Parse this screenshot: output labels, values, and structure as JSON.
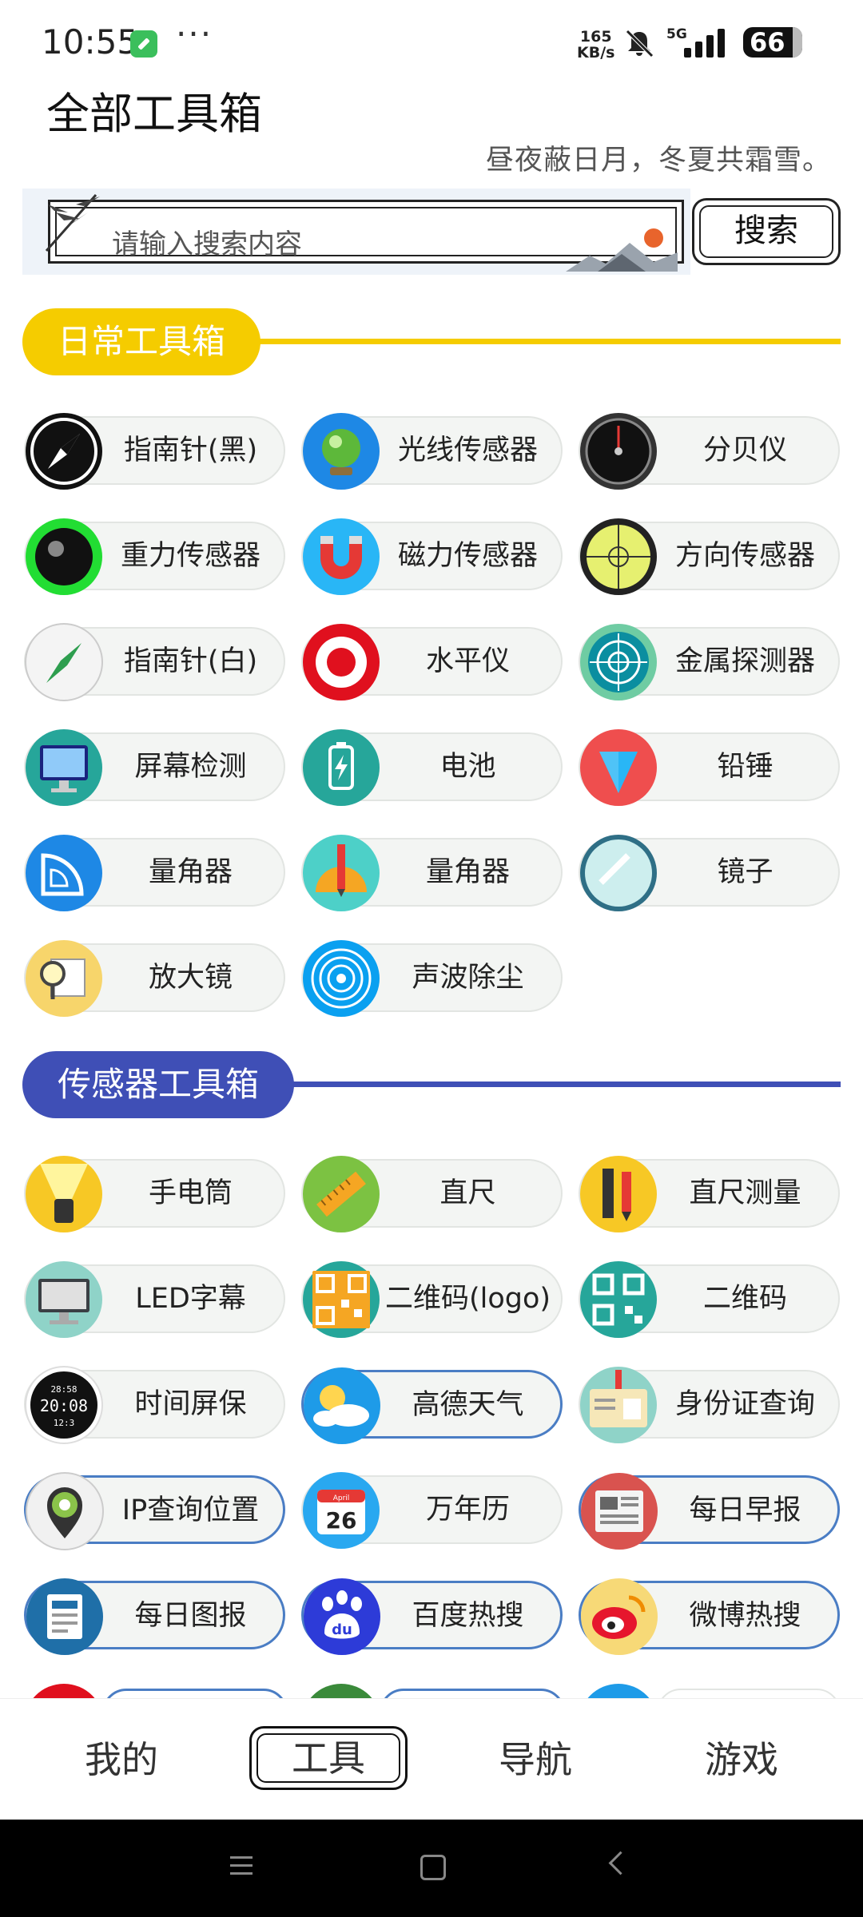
{
  "status_bar": {
    "time": "10:55",
    "dots": "···",
    "speed_value": "165",
    "speed_unit": "KB/s",
    "network": "5G",
    "battery": "66"
  },
  "header": {
    "title": "全部工具箱",
    "slogan": "昼夜蔽日月，冬夏共霜雪。"
  },
  "search": {
    "placeholder": "请输入搜索内容",
    "button_label": "搜索"
  },
  "sections": [
    {
      "title": "日常工具箱",
      "color": "#f5cc00",
      "tools": [
        {
          "label": "指南针(黑)",
          "icon": "compass-black-icon"
        },
        {
          "label": "光线传感器",
          "icon": "light-sensor-icon"
        },
        {
          "label": "分贝仪",
          "icon": "decibel-meter-icon"
        },
        {
          "label": "重力传感器",
          "icon": "gravity-sensor-icon"
        },
        {
          "label": "磁力传感器",
          "icon": "magnet-icon"
        },
        {
          "label": "方向传感器",
          "icon": "direction-sensor-icon"
        },
        {
          "label": "指南针(白)",
          "icon": "compass-white-icon"
        },
        {
          "label": "水平仪",
          "icon": "level-target-icon"
        },
        {
          "label": "金属探测器",
          "icon": "metal-detector-icon"
        },
        {
          "label": "屏幕检测",
          "icon": "screen-test-icon"
        },
        {
          "label": "电池",
          "icon": "battery-icon"
        },
        {
          "label": "铅锤",
          "icon": "plumb-bob-icon"
        },
        {
          "label": "量角器",
          "icon": "protractor-icon"
        },
        {
          "label": "量角器",
          "icon": "protractor-pencil-icon"
        },
        {
          "label": "镜子",
          "icon": "mirror-icon"
        },
        {
          "label": "放大镜",
          "icon": "magnifier-icon"
        },
        {
          "label": "声波除尘",
          "icon": "sound-wave-icon"
        }
      ]
    },
    {
      "title": "传感器工具箱",
      "color": "#3f4fb6",
      "tools": [
        {
          "label": "手电筒",
          "icon": "flashlight-icon"
        },
        {
          "label": "直尺",
          "icon": "ruler-icon"
        },
        {
          "label": "直尺测量",
          "icon": "ruler-measure-icon"
        },
        {
          "label": "LED字幕",
          "icon": "led-monitor-icon"
        },
        {
          "label": "二维码(logo)",
          "icon": "qr-logo-icon"
        },
        {
          "label": "二维码",
          "icon": "qr-code-icon"
        },
        {
          "label": "时间屏保",
          "icon": "clock-screensaver-icon",
          "clock_top": "28:58",
          "clock_mid": "20:08",
          "clock_bot": "12:3"
        },
        {
          "label": "高德天气",
          "icon": "weather-icon"
        },
        {
          "label": "身份证查询",
          "icon": "id-card-icon"
        },
        {
          "label": "IP查询位置",
          "icon": "location-pin-icon"
        },
        {
          "label": "万年历",
          "icon": "calendar-icon",
          "cal_month": "April",
          "cal_day": "26"
        },
        {
          "label": "每日早报",
          "icon": "newspaper-icon"
        },
        {
          "label": "每日图报",
          "icon": "daily-picture-icon"
        },
        {
          "label": "百度热搜",
          "icon": "baidu-icon",
          "baidu_text": "du"
        },
        {
          "label": "微博热搜",
          "icon": "weibo-icon"
        }
      ]
    }
  ],
  "bottom_nav": [
    {
      "label": "我的"
    },
    {
      "label": "工具"
    },
    {
      "label": "导航"
    },
    {
      "label": "游戏"
    }
  ]
}
